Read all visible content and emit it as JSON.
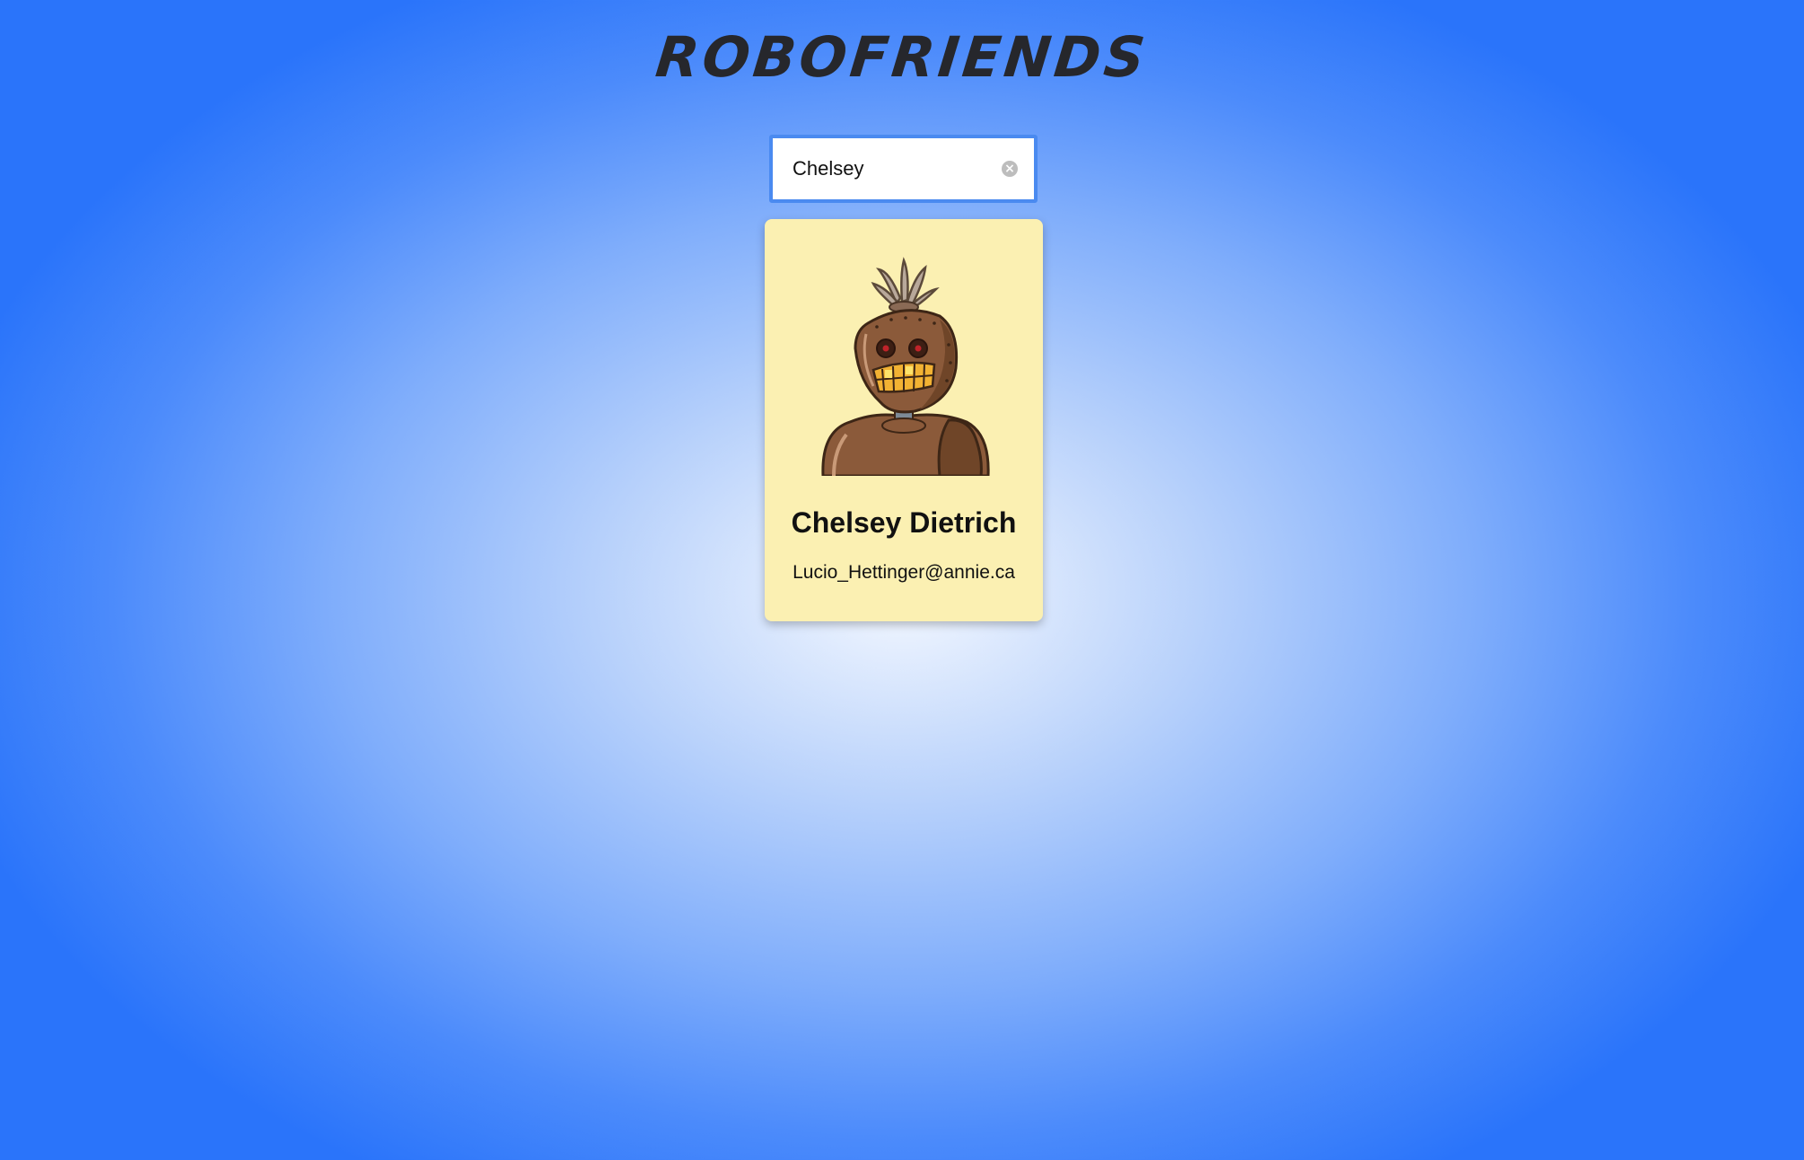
{
  "app": {
    "title": "ROBOFRIENDS"
  },
  "search": {
    "value": "Chelsey",
    "clear_icon": "clear-circle-icon"
  },
  "cards": [
    {
      "name": "Chelsey Dietrich",
      "email": "Lucio_Hettinger@annie.ca",
      "avatar_icon": "robot-avatar"
    }
  ],
  "colors": {
    "background_center": "#f4f8ff",
    "background_edge": "#2a74fa",
    "card_background": "#fbf0b2",
    "search_border": "#4a8af0",
    "title": "#26272c"
  }
}
